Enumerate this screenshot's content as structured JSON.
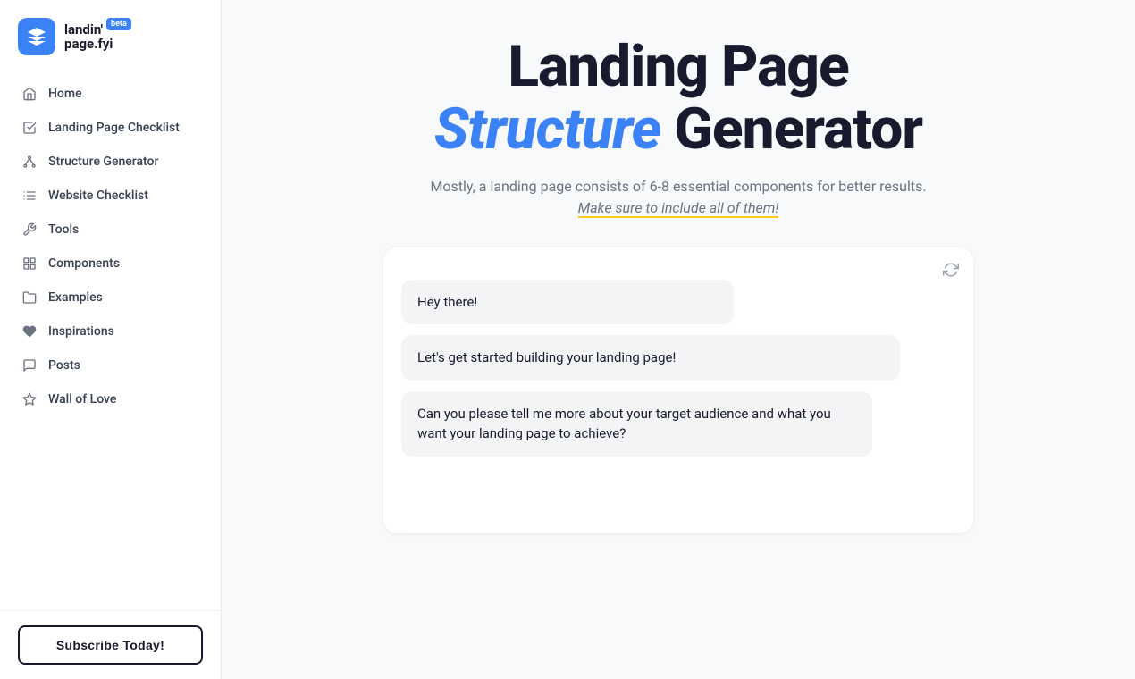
{
  "logo": {
    "name_part1": "landin'",
    "name_part2": "page.fyi",
    "beta": "beta"
  },
  "nav": {
    "items": [
      {
        "id": "home",
        "label": "Home",
        "icon": "home"
      },
      {
        "id": "landing-page-checklist",
        "label": "Landing Page Checklist",
        "icon": "checklist"
      },
      {
        "id": "structure-generator",
        "label": "Structure Generator",
        "icon": "structure"
      },
      {
        "id": "website-checklist",
        "label": "Website Checklist",
        "icon": "list"
      },
      {
        "id": "tools",
        "label": "Tools",
        "icon": "tools"
      },
      {
        "id": "components",
        "label": "Components",
        "icon": "components"
      },
      {
        "id": "examples",
        "label": "Examples",
        "icon": "examples"
      },
      {
        "id": "inspirations",
        "label": "Inspirations",
        "icon": "heart"
      },
      {
        "id": "posts",
        "label": "Posts",
        "icon": "posts"
      },
      {
        "id": "wall-of-love",
        "label": "Wall of Love",
        "icon": "love"
      }
    ]
  },
  "footer": {
    "subscribe_label": "Subscribe Today!"
  },
  "main": {
    "title_line1": "Landing Page",
    "title_line2_highlight": "Structure",
    "title_line2_rest": " Generator",
    "subtitle": "Mostly, a landing page consists of 6-8 essential components for better results.",
    "subtitle_emphasis": "Make sure to include all of them!",
    "chat": {
      "messages": [
        {
          "id": 1,
          "text": "Hey there!"
        },
        {
          "id": 2,
          "text": "Let's get started building your landing page!"
        },
        {
          "id": 3,
          "text": "Can you please tell me more about your target audience and what you want your landing page to achieve?"
        }
      ]
    }
  }
}
